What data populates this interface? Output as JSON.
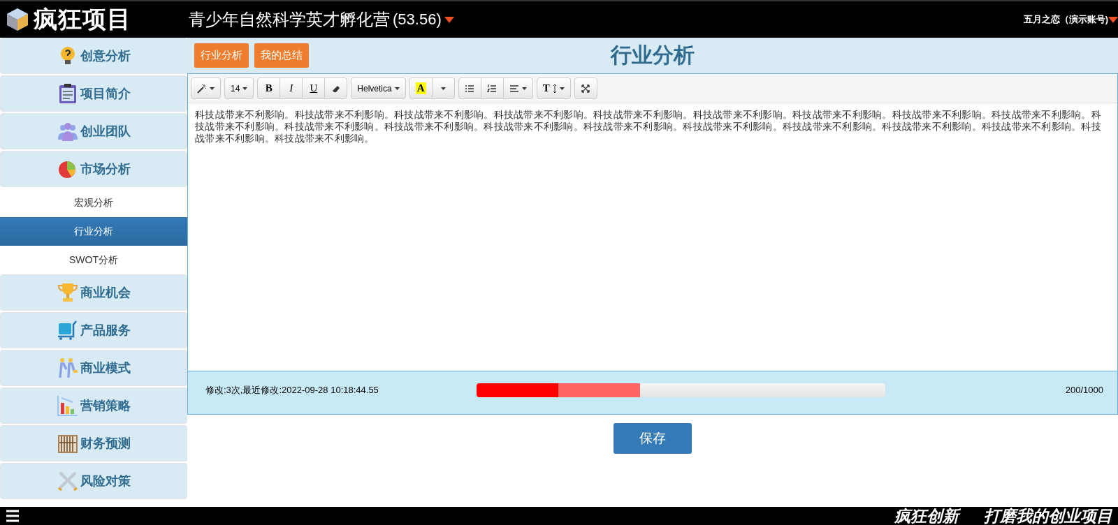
{
  "header": {
    "logo_text": "疯狂项目",
    "project_title": "青少年自然科学英才孵化营",
    "score": "(53.56)",
    "user": "五月之恋（演示账号)"
  },
  "sidebar": {
    "items": [
      {
        "kind": "section",
        "label": "创意分析"
      },
      {
        "kind": "section",
        "label": "项目简介"
      },
      {
        "kind": "section",
        "label": "创业团队"
      },
      {
        "kind": "section",
        "label": "市场分析"
      },
      {
        "kind": "sub",
        "label": "宏观分析",
        "selected": false
      },
      {
        "kind": "sub",
        "label": "行业分析",
        "selected": true
      },
      {
        "kind": "sub",
        "label": "SWOT分析",
        "selected": false
      },
      {
        "kind": "section",
        "label": "商业机会"
      },
      {
        "kind": "section",
        "label": "产品服务"
      },
      {
        "kind": "section",
        "label": "商业模式"
      },
      {
        "kind": "section",
        "label": "营销策略"
      },
      {
        "kind": "section",
        "label": "财务预测"
      },
      {
        "kind": "section",
        "label": "风险对策"
      }
    ]
  },
  "tabs": [
    {
      "label": "行业分析"
    },
    {
      "label": "我的总结"
    }
  ],
  "page_title": "行业分析",
  "toolbar": {
    "groups": [
      [
        {
          "kind": "magic",
          "dropdown": true
        }
      ],
      [
        {
          "kind": "size",
          "label": "14",
          "dropdown": true
        }
      ],
      [
        {
          "kind": "bold",
          "label": "B"
        },
        {
          "kind": "italic",
          "label": "I"
        },
        {
          "kind": "underline",
          "label": "U"
        },
        {
          "kind": "eraser"
        }
      ],
      [
        {
          "kind": "font",
          "label": "Helvetica",
          "dropdown": true
        }
      ],
      [
        {
          "kind": "color",
          "label": "A"
        },
        {
          "kind": "caret",
          "dropdown": true
        }
      ],
      [
        {
          "kind": "ul"
        },
        {
          "kind": "ol"
        },
        {
          "kind": "align",
          "dropdown": true
        }
      ],
      [
        {
          "kind": "height",
          "label": "T",
          "dropdown": true
        }
      ],
      [
        {
          "kind": "fullscreen"
        }
      ]
    ]
  },
  "editor_text": "科技战带来不利影响。科技战带来不利影响。科技战带来不利影响。科技战带来不利影响。科技战带来不利影响。科技战带来不利影响。科技战带来不利影响。科技战带来不利影响。科技战带来不利影响。科技战带来不利影响。科技战带来不利影响。科技战带来不利影响。科技战带来不利影响。科技战带来不利影响。科技战带来不利影响。科技战带来不利影响。科技战带来不利影响。科技战带来不利影响。科技战带来不利影响。科技战带来不利影响。",
  "status": {
    "history": "修改:3次,最近修改:2022-09-28 10:18:44.55",
    "segments": [
      {
        "level": 0.2,
        "color": "#ff0000"
      },
      {
        "level": 0.2,
        "color": "#ff6666"
      }
    ],
    "count": "200/1000"
  },
  "save_button": "保存",
  "footer": {
    "slogans": [
      "疯狂创新",
      "打磨我的创业项目"
    ]
  }
}
